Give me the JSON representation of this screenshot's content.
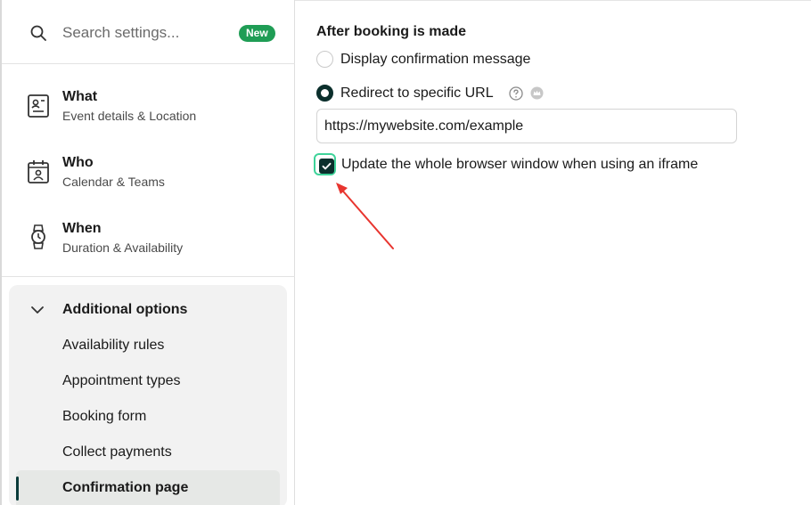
{
  "search": {
    "placeholder": "Search settings...",
    "badge": "New"
  },
  "nav": [
    {
      "title": "What",
      "subtitle": "Event details & Location",
      "icon": "contact-card-icon"
    },
    {
      "title": "Who",
      "subtitle": "Calendar & Teams",
      "icon": "calendar-user-icon"
    },
    {
      "title": "When",
      "subtitle": "Duration & Availability",
      "icon": "watch-icon"
    }
  ],
  "additional": {
    "heading": "Additional options",
    "items": [
      "Availability rules",
      "Appointment types",
      "Booking form",
      "Collect payments",
      "Confirmation page"
    ],
    "active_index": 4
  },
  "main": {
    "section_title": "After booking is made",
    "option_confirmation": "Display confirmation message",
    "option_redirect": "Redirect to specific URL",
    "selected_option": "Redirect to specific URL",
    "url_value": "https://mywebsite.com/example",
    "iframe_checkbox_label": "Update the whole browser window when using an iframe",
    "iframe_checkbox_checked": true
  },
  "colors": {
    "badge_green": "#1f9d55",
    "accent_dark": "#0b2f2c",
    "focus_ring": "#3fd39a",
    "annotation_arrow": "#e8352f"
  }
}
